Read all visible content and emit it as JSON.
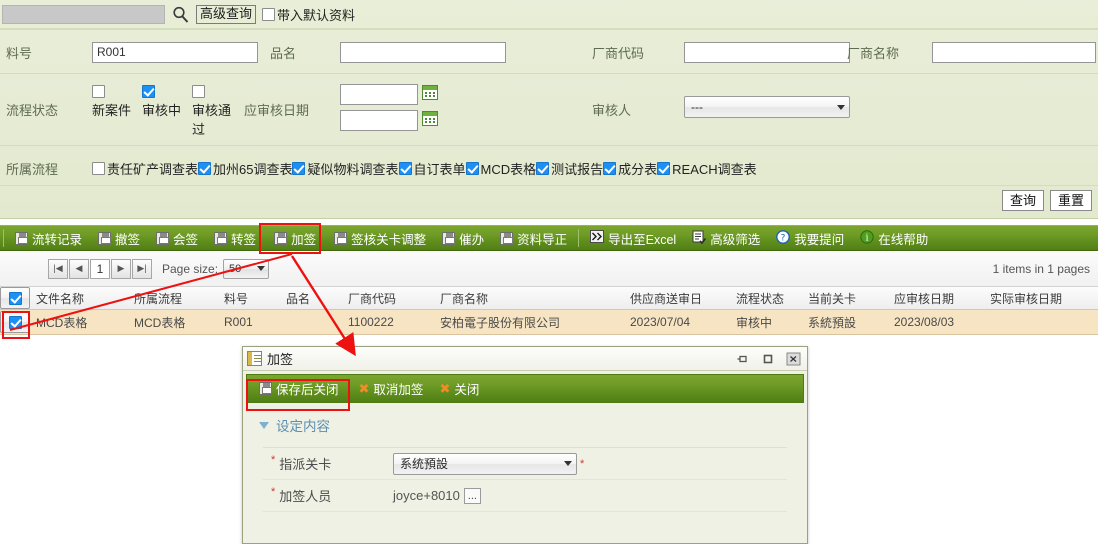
{
  "search": {
    "value": "",
    "placeholder": "",
    "advanced_button": "高级查询",
    "default_data_label": "带入默认资料"
  },
  "form": {
    "material_no_label": "料号",
    "material_no_value": "R001",
    "product_name_label": "品名",
    "product_name_value": "",
    "vendor_code_label": "厂商代码",
    "vendor_code_value": "",
    "vendor_name_label": "厂商名称",
    "vendor_name_value": "",
    "flow_status_label": "流程状态",
    "flow_status_options": [
      {
        "label": "新案件",
        "checked": false
      },
      {
        "label": "审核中",
        "checked": true
      },
      {
        "label": "审核通过",
        "checked": false
      }
    ],
    "review_date_label": "应审核日期",
    "review_date_from": "",
    "review_date_to": "",
    "reviewer_label": "审核人",
    "reviewer_value": "---",
    "belong_flow_label": "所属流程",
    "belong_flow_options": [
      {
        "label": "责任矿产调查表",
        "checked": false
      },
      {
        "label": "加州65调查表",
        "checked": true
      },
      {
        "label": "疑似物料调查表",
        "checked": true
      },
      {
        "label": "自订表单",
        "checked": true
      },
      {
        "label": "MCD表格",
        "checked": true
      },
      {
        "label": "测试报告",
        "checked": true
      },
      {
        "label": "成分表",
        "checked": true
      },
      {
        "label": "REACH调查表",
        "checked": true
      }
    ],
    "query_button": "查询",
    "reset_button": "重置"
  },
  "toolbar": {
    "left_items": [
      {
        "label": "流转记录",
        "icon": "disk-icon"
      },
      {
        "label": "撤签",
        "icon": "disk-icon"
      },
      {
        "label": "会签",
        "icon": "disk-icon"
      },
      {
        "label": "转签",
        "icon": "disk-icon"
      },
      {
        "label": "加签",
        "icon": "disk-icon"
      },
      {
        "label": "签核关卡调整",
        "icon": "disk-icon"
      },
      {
        "label": "催办",
        "icon": "disk-icon"
      },
      {
        "label": "资料导正",
        "icon": "disk-icon"
      }
    ],
    "right_items": [
      {
        "label": "导出至Excel",
        "icon": "excel-icon"
      },
      {
        "label": "高级筛选",
        "icon": "filter-icon"
      },
      {
        "label": "我要提问",
        "icon": "question-icon"
      },
      {
        "label": "在线帮助",
        "icon": "info-icon"
      }
    ]
  },
  "pager": {
    "first": "|◀",
    "prev": "◀",
    "page": "1",
    "next": "▶",
    "last": "▶|",
    "page_size_label": "Page size:",
    "page_size_value": "50",
    "items_info": "1 items in 1 pages"
  },
  "grid": {
    "columns": [
      "文件名称",
      "所属流程",
      "料号",
      "品名",
      "厂商代码",
      "厂商名称",
      "供应商送审日",
      "流程状态",
      "当前关卡",
      "应审核日期",
      "实际审核日期"
    ],
    "header_checked": true,
    "rows": [
      {
        "checked": true,
        "cells": [
          "MCD表格",
          "MCD表格",
          "R001",
          "",
          "1100222",
          "安柏電子股份有限公司",
          "2023/07/04",
          "审核中",
          "系統預設",
          "2023/08/03",
          ""
        ]
      }
    ]
  },
  "dialog": {
    "title": "加签",
    "window_buttons": [
      "pin-icon",
      "maximize-icon",
      "close-icon"
    ],
    "toolbar": [
      {
        "label": "保存后关闭",
        "icon": "disk-icon"
      },
      {
        "label": "取消加签",
        "icon": "x-icon"
      },
      {
        "label": "关闭",
        "icon": "x-icon"
      }
    ],
    "section_title": "设定内容",
    "fields": [
      {
        "label": "指派关卡",
        "value": "系统預設",
        "required": true,
        "type": "select"
      },
      {
        "label": "加签人员",
        "value": "joyce+8010",
        "required": true,
        "type": "lookup"
      }
    ]
  },
  "colors": {
    "accent_green": "#5d8c1c",
    "panel_bg": "#e6ecd4",
    "row_highlight": "#f7e4c3",
    "annotation_red": "#ee1111",
    "checkbox_blue": "#1e90f5"
  }
}
